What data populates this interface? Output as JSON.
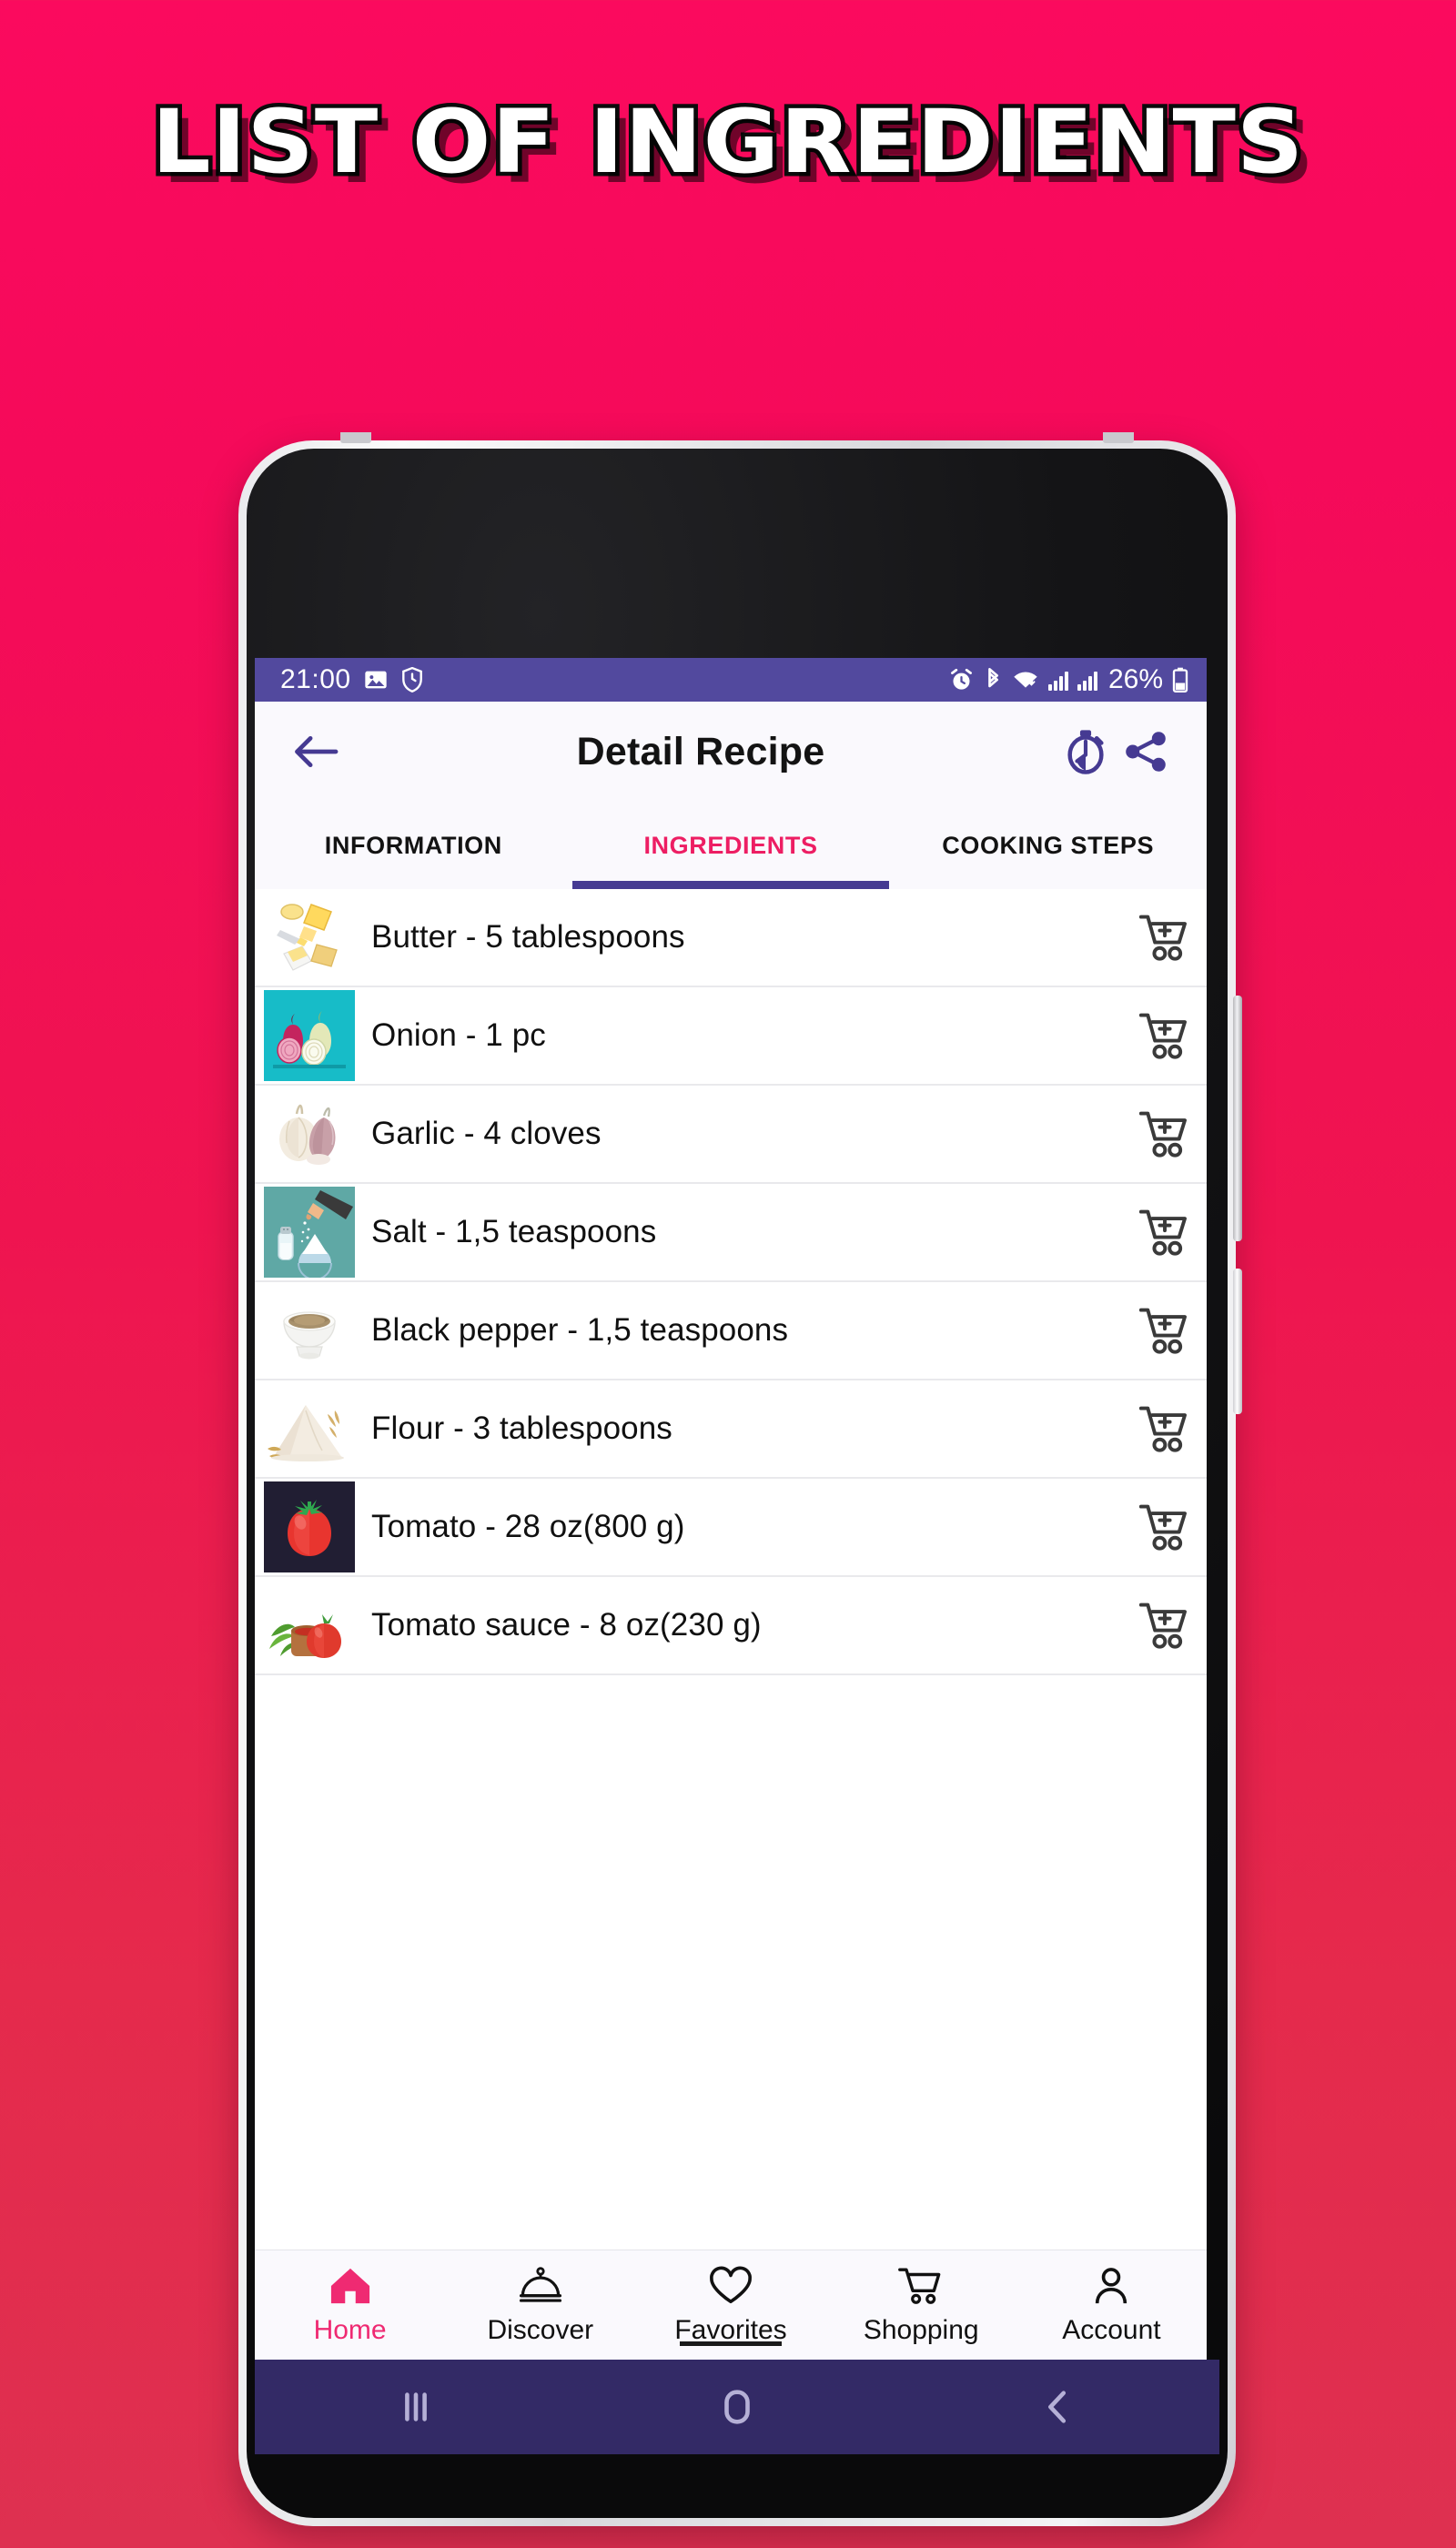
{
  "poster": {
    "headline": "LIST OF INGREDIENTS",
    "background_top": "#fb0a5e",
    "background_bottom": "#de3050"
  },
  "statusbar": {
    "time": "21:00",
    "battery_percent": "26%",
    "icons_left": [
      "image-icon",
      "clock-shield-icon"
    ],
    "icons_right": [
      "alarm-icon",
      "bluetooth-icon",
      "wifi-icon",
      "signal-bars-icon",
      "signal-bars-icon",
      "battery-icon"
    ],
    "background": "#52499e"
  },
  "appbar": {
    "back_icon": "arrow-left-icon",
    "title": "Detail Recipe",
    "timer_icon": "timer-icon",
    "share_icon": "share-icon",
    "accent": "#453a92"
  },
  "tabs": {
    "items": [
      {
        "label": "INFORMATION",
        "active": false
      },
      {
        "label": "INGREDIENTS",
        "active": true
      },
      {
        "label": "COOKING STEPS",
        "active": false
      }
    ],
    "active_color": "#ed1e63",
    "indicator_color": "#453a92"
  },
  "ingredients": {
    "items": [
      {
        "label": "Butter - 5 tablespoons",
        "thumb": "butter-thumb",
        "action_icon": "add-to-cart-icon"
      },
      {
        "label": "Onion - 1 pc",
        "thumb": "onion-thumb",
        "action_icon": "add-to-cart-icon"
      },
      {
        "label": "Garlic - 4 cloves",
        "thumb": "garlic-thumb",
        "action_icon": "add-to-cart-icon"
      },
      {
        "label": "Salt - 1,5 teaspoons",
        "thumb": "salt-thumb",
        "action_icon": "add-to-cart-icon"
      },
      {
        "label": "Black pepper - 1,5 teaspoons",
        "thumb": "black-pepper-thumb",
        "action_icon": "add-to-cart-icon"
      },
      {
        "label": "Flour - 3 tablespoons",
        "thumb": "flour-thumb",
        "action_icon": "add-to-cart-icon"
      },
      {
        "label": "Tomato - 28 oz(800 g)",
        "thumb": "tomato-thumb",
        "action_icon": "add-to-cart-icon"
      },
      {
        "label": "Tomato sauce - 8 oz(230 g)",
        "thumb": "tomato-sauce-thumb",
        "action_icon": "add-to-cart-icon"
      }
    ]
  },
  "bottomnav": {
    "items": [
      {
        "label": "Home",
        "icon": "home-icon",
        "active": true
      },
      {
        "label": "Discover",
        "icon": "cloche-icon",
        "active": false
      },
      {
        "label": "Favorites",
        "icon": "heart-icon",
        "active": false
      },
      {
        "label": "Shopping",
        "icon": "cart-icon",
        "active": false
      },
      {
        "label": "Account",
        "icon": "person-icon",
        "active": false
      }
    ],
    "active_color": "#ef2a72"
  },
  "androidnav": {
    "recents_icon": "recents-icon",
    "home_icon": "home-square-icon",
    "back_icon": "chevron-left-icon",
    "background": "#332a66"
  }
}
